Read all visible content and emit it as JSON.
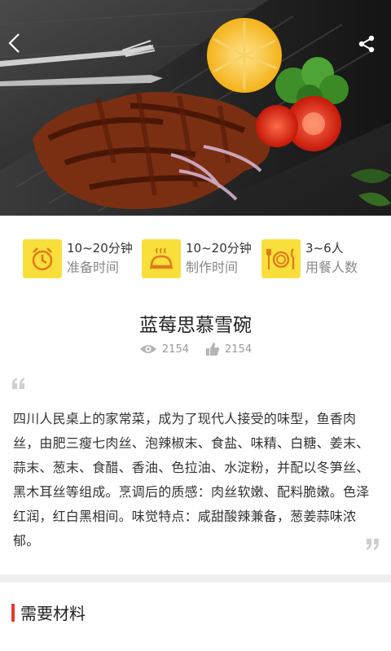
{
  "hero": {
    "back_icon": "chevron-left-icon",
    "share_icon": "share-icon"
  },
  "info": [
    {
      "icon": "alarm-clock-icon",
      "value": "10~20分钟",
      "label": "准备时间"
    },
    {
      "icon": "food-cloche-icon",
      "value": "10~20分钟",
      "label": "制作时间"
    },
    {
      "icon": "plate-cutlery-icon",
      "value": "3~6人",
      "label": "用餐人数"
    }
  ],
  "recipe": {
    "title": "蓝莓思慕雪碗",
    "views": "2154",
    "likes": "2154",
    "description": "四川人民桌上的家常菜，成为了现代人接受的味型，鱼香肉丝，由肥三瘦七肉丝、泡辣椒末、食盐、味精、白糖、姜末、蒜末、葱末、食醋、香油、色拉油、水淀粉，并配以冬笋丝、黑木耳丝等组成。烹调后的质感：肉丝软嫩、配料脆嫩。色泽红润，红白黑相间。味觉特点：咸甜酸辣兼备，葱姜蒜味浓郁。"
  },
  "section": {
    "title": "需要材料"
  },
  "colors": {
    "icon_bg": "#f8df3c",
    "accent_bar": "#e53a2a"
  }
}
